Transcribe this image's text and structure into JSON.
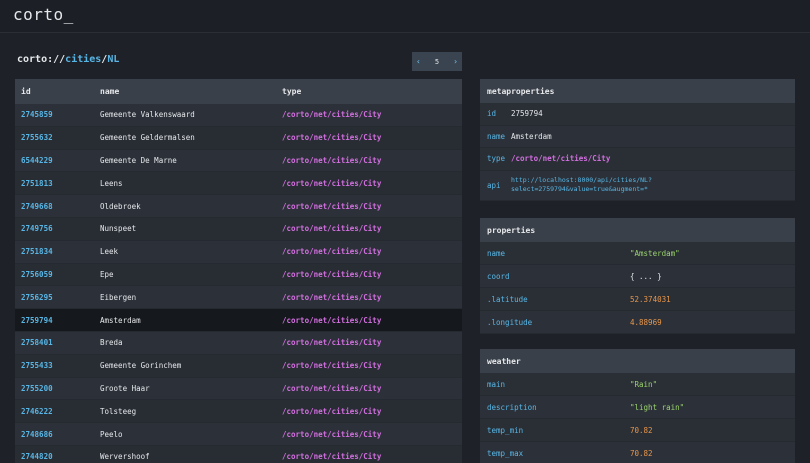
{
  "app": {
    "logo": "corto_"
  },
  "breadcrumb": {
    "root": "corto://",
    "seg1": "cities",
    "sep": "/",
    "seg2": "NL"
  },
  "pager": {
    "prev": "‹",
    "page": "5",
    "next": "›"
  },
  "table": {
    "headers": [
      "id",
      "name",
      "type"
    ],
    "rows": [
      [
        "2745859",
        "Gemeente Valkenswaard",
        "/corto/net/cities/City"
      ],
      [
        "2755632",
        "Gemeente Geldermalsen",
        "/corto/net/cities/City"
      ],
      [
        "6544229",
        "Gemeente De Marne",
        "/corto/net/cities/City"
      ],
      [
        "2751813",
        "Leens",
        "/corto/net/cities/City"
      ],
      [
        "2749668",
        "Oldebroek",
        "/corto/net/cities/City"
      ],
      [
        "2749756",
        "Nunspeet",
        "/corto/net/cities/City"
      ],
      [
        "2751834",
        "Leek",
        "/corto/net/cities/City"
      ],
      [
        "2756059",
        "Epe",
        "/corto/net/cities/City"
      ],
      [
        "2756295",
        "Eibergen",
        "/corto/net/cities/City"
      ],
      [
        "2759794",
        "Amsterdam",
        "/corto/net/cities/City"
      ],
      [
        "2758401",
        "Breda",
        "/corto/net/cities/City"
      ],
      [
        "2755433",
        "Gemeente Gorinchem",
        "/corto/net/cities/City"
      ],
      [
        "2755200",
        "Groote Haar",
        "/corto/net/cities/City"
      ],
      [
        "2746222",
        "Tolsteeg",
        "/corto/net/cities/City"
      ],
      [
        "2748686",
        "Peelo",
        "/corto/net/cities/City"
      ],
      [
        "2744820",
        "Wervershoof",
        "/corto/net/cities/City"
      ]
    ]
  },
  "metaproperties": {
    "title": "metaproperties",
    "id_key": "id",
    "id_val": "2759794",
    "name_key": "name",
    "name_val": "Amsterdam",
    "type_key": "type",
    "type_val": "/corto/net/cities/City",
    "api_key": "api",
    "api_line1": "http://localhost:8000/api/cities/NL?",
    "api_line2": "select=2759794&value=true&augment=*"
  },
  "properties": {
    "title": "properties",
    "rows": [
      {
        "k": "name",
        "v": "\"Amsterdam\""
      },
      {
        "k": "coord",
        "v": "{ ... }"
      },
      {
        "k": ".latitude",
        "v": "52.374031"
      },
      {
        "k": ".longitude",
        "v": "4.88969"
      }
    ]
  },
  "weather": {
    "title": "weather",
    "rows": [
      {
        "k": "main",
        "v": "\"Rain\""
      },
      {
        "k": "description",
        "v": "\"light rain\""
      },
      {
        "k": "temp_min",
        "v": "70.82"
      },
      {
        "k": "temp_max",
        "v": "70.82"
      }
    ]
  },
  "colors": {
    "accent": "#58b6e6",
    "type": "#d36fe0",
    "string": "#9bd36e",
    "number": "#e8964a"
  }
}
